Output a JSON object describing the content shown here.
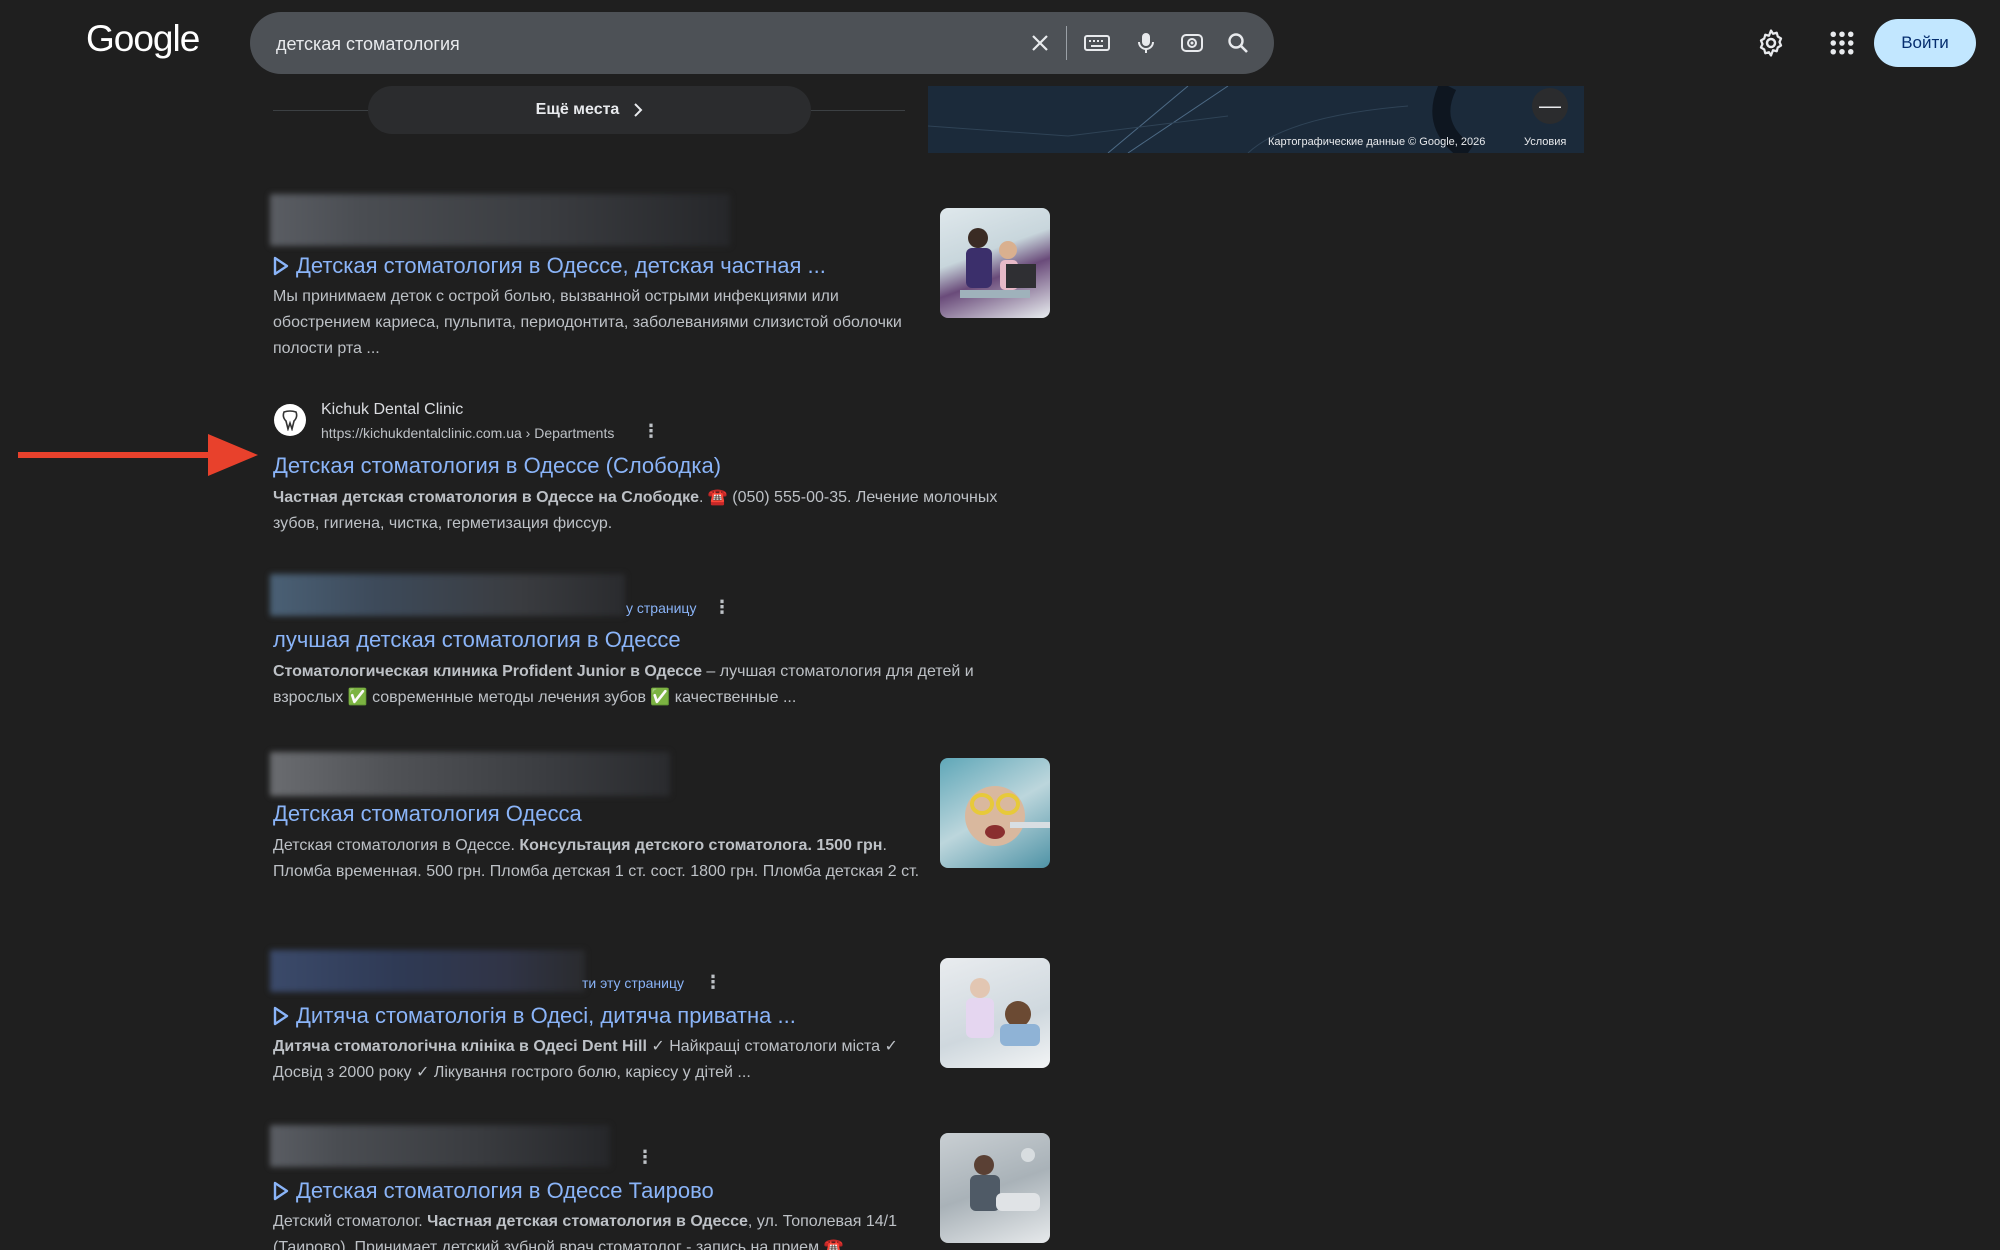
{
  "header": {
    "logo": "Google",
    "search_query": "детская стоматология",
    "signin_label": "Войти"
  },
  "places": {
    "more_label": "Ещё места",
    "map_attribution": "Картографические данные © Google, 2026",
    "map_terms": "Условия",
    "map_zoom_out": "—"
  },
  "results": [
    {
      "title": "Детская стоматология в Одессе, детская частная ...",
      "snippet": "Мы принимаем деток с острой болью, вызванной острыми инфекциями или обострением кариеса, пульпита, периодонтита, заболеваниями слизистой оболочки полости рта ..."
    },
    {
      "site_name": "Kichuk Dental Clinic",
      "url": "https://kichukdentalclinic.com.ua › Departments",
      "title": "Детская стоматология в Одессе (Слободка)",
      "snippet_bold": "Частная детская стоматология в Одессе на Слободке",
      "snippet_rest": ". ☎️ (050) 555-00-35. Лечение молочных зубов, гигиена, чистка, герметизация фиссур."
    },
    {
      "partial_link": "у страницу",
      "title": "лучшая детская стоматология в Одессе",
      "snippet_bold": "Стоматологическая клиника Profident Junior в Одессе",
      "snippet_rest": " – лучшая стоматология для детей и взрослых ✅ современные методы лечения зубов ✅ качественные ..."
    },
    {
      "title": "Детская стоматология Одесса",
      "snippet_pre": "Детская стоматология в Одессе. ",
      "snippet_bold": "Консультация детского стоматолога. 1500 грн",
      "snippet_rest": ". Пломба временная. 500 грн. Пломба детская 1 ст. сост. 1800 грн. Пломба детская 2 ст."
    },
    {
      "partial_link": "ти эту страницу",
      "title": "Дитяча стоматологія в Одесі, дитяча приватна ...",
      "snippet_bold": "Дитяча стоматологічна клініка в Одесі Dent Hill",
      "snippet_rest": " ✓ Найкращі стоматологи міста ✓ Досвід з 2000 року ✓ Лікування гострого болю, карієсу у дітей ..."
    },
    {
      "title": "Детская стоматология в Одессе Таирово",
      "snippet_pre": "Детский стоматолог. ",
      "snippet_bold": "Частная детская стоматология в Одессе",
      "snippet_rest": ", ул. Тополевая 14/1 (Таирово). Принимает детский зубной врач стоматолог - запись на прием ☎️"
    }
  ],
  "colors": {
    "background": "#1f1f1f",
    "link": "#8ab4f8",
    "arrow": "#e8412c",
    "signin_bg": "#c2e7ff"
  }
}
